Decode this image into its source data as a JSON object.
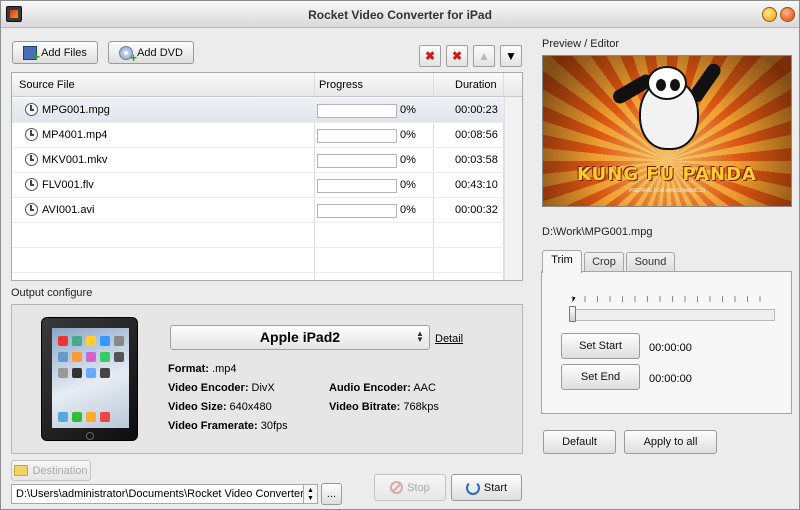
{
  "window": {
    "title": "Rocket Video Converter for iPad"
  },
  "toolbar": {
    "add_files_label": "Add Files",
    "add_dvd_label": "Add DVD"
  },
  "table": {
    "headers": {
      "source": "Source File",
      "progress": "Progress",
      "duration": "Duration"
    },
    "rows": [
      {
        "name": "MPG001.mpg",
        "progress_text": "0%",
        "progress": 0,
        "duration": "00:00:23",
        "selected": true
      },
      {
        "name": "MP4001.mp4",
        "progress_text": "0%",
        "progress": 0,
        "duration": "00:08:56",
        "selected": false
      },
      {
        "name": "MKV001.mkv",
        "progress_text": "0%",
        "progress": 0,
        "duration": "00:03:58",
        "selected": false
      },
      {
        "name": "FLV001.flv",
        "progress_text": "0%",
        "progress": 0,
        "duration": "00:43:10",
        "selected": false
      },
      {
        "name": "AVI001.avi",
        "progress_text": "0%",
        "progress": 0,
        "duration": "00:00:32",
        "selected": false
      }
    ]
  },
  "output": {
    "section_label": "Output configure",
    "profile": "Apple iPad2",
    "detail_link": "Detail",
    "format_label": "Format:",
    "format_value": ".mp4",
    "video_encoder_label": "Video Encoder:",
    "video_encoder_value": "DivX",
    "audio_encoder_label": "Audio Encoder:",
    "audio_encoder_value": "AAC",
    "video_size_label": "Video Size:",
    "video_size_value": "640x480",
    "video_bitrate_label": "Video Bitrate:",
    "video_bitrate_value": "768kps",
    "video_framerate_label": "Video Framerate:",
    "video_framerate_value": "30fps"
  },
  "destination": {
    "button_label": "Destination",
    "path": "D:\\Users\\administrator\\Documents\\Rocket Video Converter",
    "browse_label": "..."
  },
  "actions": {
    "stop_label": "Stop",
    "start_label": "Start"
  },
  "preview": {
    "section_label": "Preview / Editor",
    "poster_title": "KUNG FU PANDA",
    "poster_tagline": "PREPARE FOR AWESOMENESS",
    "file_path": "D:\\Work\\MPG001.mpg"
  },
  "editor": {
    "tabs": [
      "Trim",
      "Crop",
      "Sound"
    ],
    "active_tab": "Trim",
    "set_start_label": "Set Start",
    "set_end_label": "Set End",
    "start_time": "00:00:00",
    "end_time": "00:00:00"
  },
  "bottom_right": {
    "default_label": "Default",
    "apply_all_label": "Apply to all"
  }
}
